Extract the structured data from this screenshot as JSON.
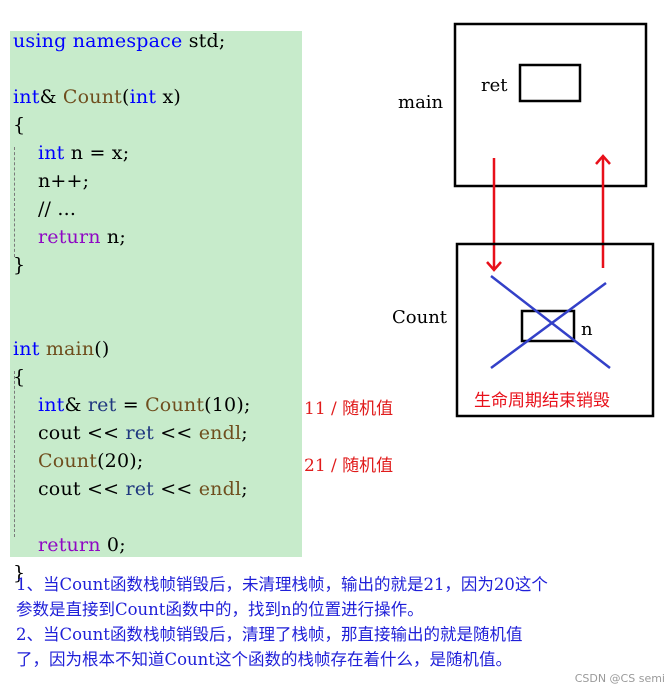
{
  "code": {
    "lines": [
      [
        {
          "t": "using namespace ",
          "c": "kw"
        },
        {
          "t": "std;",
          "c": ""
        }
      ],
      [],
      [
        {
          "t": "int",
          "c": "kw"
        },
        {
          "t": "& ",
          "c": ""
        },
        {
          "t": "Count",
          "c": "fn"
        },
        {
          "t": "(",
          "c": ""
        },
        {
          "t": "int",
          "c": "kw"
        },
        {
          "t": " x)",
          "c": ""
        }
      ],
      [
        {
          "t": "{",
          "c": ""
        }
      ],
      [
        {
          "t": "    ",
          "c": ""
        },
        {
          "t": "int",
          "c": "kw"
        },
        {
          "t": " n = x;",
          "c": ""
        }
      ],
      [
        {
          "t": "    n++;",
          "c": ""
        }
      ],
      [
        {
          "t": "    // ...",
          "c": ""
        }
      ],
      [
        {
          "t": "    ",
          "c": ""
        },
        {
          "t": "return",
          "c": "ret"
        },
        {
          "t": " n;",
          "c": ""
        }
      ],
      [
        {
          "t": "}",
          "c": ""
        }
      ],
      [],
      [],
      [
        {
          "t": "int",
          "c": "kw"
        },
        {
          "t": " ",
          "c": ""
        },
        {
          "t": "main",
          "c": "fn"
        },
        {
          "t": "()",
          "c": ""
        }
      ],
      [
        {
          "t": "{",
          "c": ""
        }
      ],
      [
        {
          "t": "    ",
          "c": ""
        },
        {
          "t": "int",
          "c": "kw"
        },
        {
          "t": "& ",
          "c": ""
        },
        {
          "t": "ret",
          "c": "var"
        },
        {
          "t": " = ",
          "c": ""
        },
        {
          "t": "Count",
          "c": "fn"
        },
        {
          "t": "(10);",
          "c": ""
        }
      ],
      [
        {
          "t": "    cout << ",
          "c": ""
        },
        {
          "t": "ret",
          "c": "var"
        },
        {
          "t": " << ",
          "c": ""
        },
        {
          "t": "endl",
          "c": "fn"
        },
        {
          "t": ";",
          "c": ""
        }
      ],
      [
        {
          "t": "    ",
          "c": ""
        },
        {
          "t": "Count",
          "c": "fn"
        },
        {
          "t": "(20);",
          "c": ""
        }
      ],
      [
        {
          "t": "    cout << ",
          "c": ""
        },
        {
          "t": "ret",
          "c": "var"
        },
        {
          "t": " << ",
          "c": ""
        },
        {
          "t": "endl",
          "c": "fn"
        },
        {
          "t": ";",
          "c": ""
        }
      ],
      [],
      [
        {
          "t": "    ",
          "c": ""
        },
        {
          "t": "return",
          "c": "ret"
        },
        {
          "t": " 0;",
          "c": ""
        }
      ],
      [
        {
          "t": "}",
          "c": ""
        }
      ]
    ]
  },
  "annotations": {
    "first_output": "11 / 随机值",
    "second_output": "21 / 随机值"
  },
  "diagram": {
    "main_frame_label": "main",
    "ret_label": "ret",
    "count_frame_label": "Count",
    "n_label": "n",
    "destroyed_caption": "生命周期结束销毁",
    "colors": {
      "arrow": "#e8101a",
      "cross": "#3340c8",
      "frame": "#000000",
      "caption": "#e8101a"
    }
  },
  "explanation": {
    "lines": [
      "1、当Count函数栈帧销毁后，未清理栈帧，输出的就是21，因为20这个",
      "参数是直接到Count函数中的，找到n的位置进行操作。",
      "2、当Count函数栈帧销毁后，清理了栈帧，那直接输出的就是随机值",
      "了，因为根本不知道Count这个函数的栈帧存在着什么，是随机值。"
    ]
  },
  "watermark": "CSDN @CS semi"
}
